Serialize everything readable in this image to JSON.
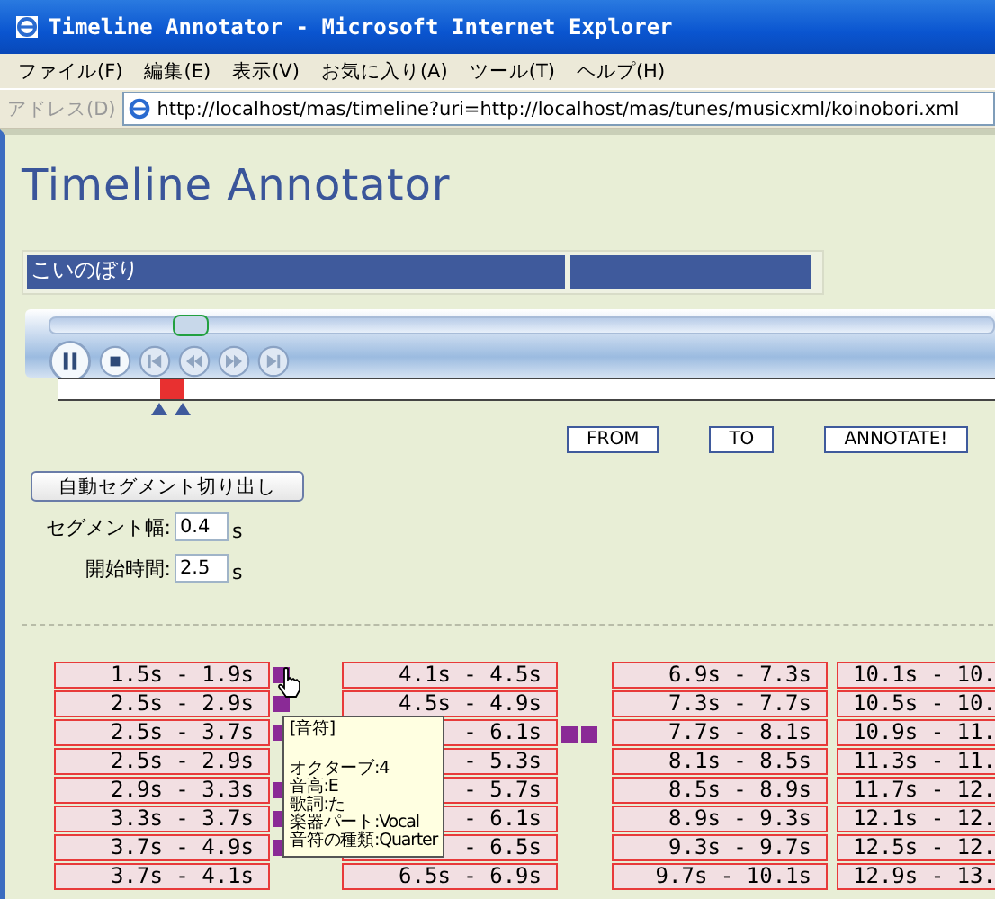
{
  "window": {
    "title": "Timeline Annotator - Microsoft Internet Explorer"
  },
  "menu": [
    "ファイル(F)",
    "編集(E)",
    "表示(V)",
    "お気に入り(A)",
    "ツール(T)",
    "ヘルプ(H)"
  ],
  "address": {
    "label": "アドレス(D)",
    "url": "http://localhost/mas/timeline?uri=http://localhost/mas/tunes/musicxml/koinobori.xml"
  },
  "page": {
    "heading": "Timeline Annotator",
    "song_title": "こいのぼり",
    "player": {
      "seek": {
        "level": 0.13
      },
      "buttons": [
        {
          "kind": "pause",
          "disabled": false
        },
        {
          "kind": "stop",
          "disabled": false
        },
        {
          "kind": "prev",
          "disabled": true
        },
        {
          "kind": "rewind",
          "disabled": true
        },
        {
          "kind": "forward",
          "disabled": true
        },
        {
          "kind": "next",
          "disabled": true
        }
      ]
    },
    "timeline": {
      "marker": {
        "level": 0.11
      }
    },
    "buttons": [
      "FROM",
      "TO",
      "ANNOTATE!"
    ],
    "auto_segment_button": "自動セグメント切り出し",
    "fields": [
      {
        "label": "セグメント幅:",
        "value": "0.4",
        "unit": "s"
      },
      {
        "label": "開始時間:",
        "value": "2.5",
        "unit": "s"
      }
    ],
    "columns": [
      [
        {
          "text": "1.5s - 1.9s",
          "marks": [
            {
              "kind": "note"
            }
          ]
        },
        {
          "text": "2.5s - 2.9s",
          "marks": [
            {
              "kind": "note"
            }
          ]
        },
        {
          "text": "2.5s - 3.7s",
          "marks": [
            {
              "kind": "note"
            }
          ]
        },
        {
          "text": "2.5s - 2.9s"
        },
        {
          "text": "2.9s - 3.3s",
          "marks": [
            {
              "kind": "note"
            }
          ]
        },
        {
          "text": "3.3s - 3.7s",
          "marks": [
            {
              "kind": "note"
            }
          ]
        },
        {
          "text": "3.7s - 4.9s",
          "marks": [
            {
              "kind": "note"
            }
          ]
        },
        {
          "text": "3.7s - 4.1s"
        }
      ],
      [
        {
          "text": "4.1s - 4.5s"
        },
        {
          "text": "4.5s - 4.9s"
        },
        {
          "text": "- 6.1s",
          "marks": [
            {
              "kind": "note"
            },
            {
              "kind": "note"
            }
          ]
        },
        {
          "text": "- 5.3s"
        },
        {
          "text": "- 5.7s"
        },
        {
          "text": "- 6.1s"
        },
        {
          "text": "- 6.5s"
        },
        {
          "text": "6.5s - 6.9s"
        }
      ],
      [
        {
          "text": "6.9s - 7.3s"
        },
        {
          "text": "7.3s - 7.7s"
        },
        {
          "text": "7.7s - 8.1s"
        },
        {
          "text": "8.1s - 8.5s"
        },
        {
          "text": "8.5s - 8.9s"
        },
        {
          "text": "8.9s - 9.3s"
        },
        {
          "text": "9.3s - 9.7s"
        },
        {
          "text": "9.7s - 10.1s"
        }
      ],
      [
        {
          "text": "10.1s - 10."
        },
        {
          "text": "10.5s - 10."
        },
        {
          "text": "10.9s - 11."
        },
        {
          "text": "11.3s - 11."
        },
        {
          "text": "11.7s - 12."
        },
        {
          "text": "12.1s - 12."
        },
        {
          "text": "12.5s - 12."
        },
        {
          "text": "12.9s - 13."
        }
      ]
    ],
    "tooltip": {
      "title": "[音符]",
      "lines": [
        "オクターブ:4",
        "音高:E",
        "歌詞:た",
        "楽器パート:Vocal",
        "音符の種類:Quarter"
      ]
    }
  }
}
